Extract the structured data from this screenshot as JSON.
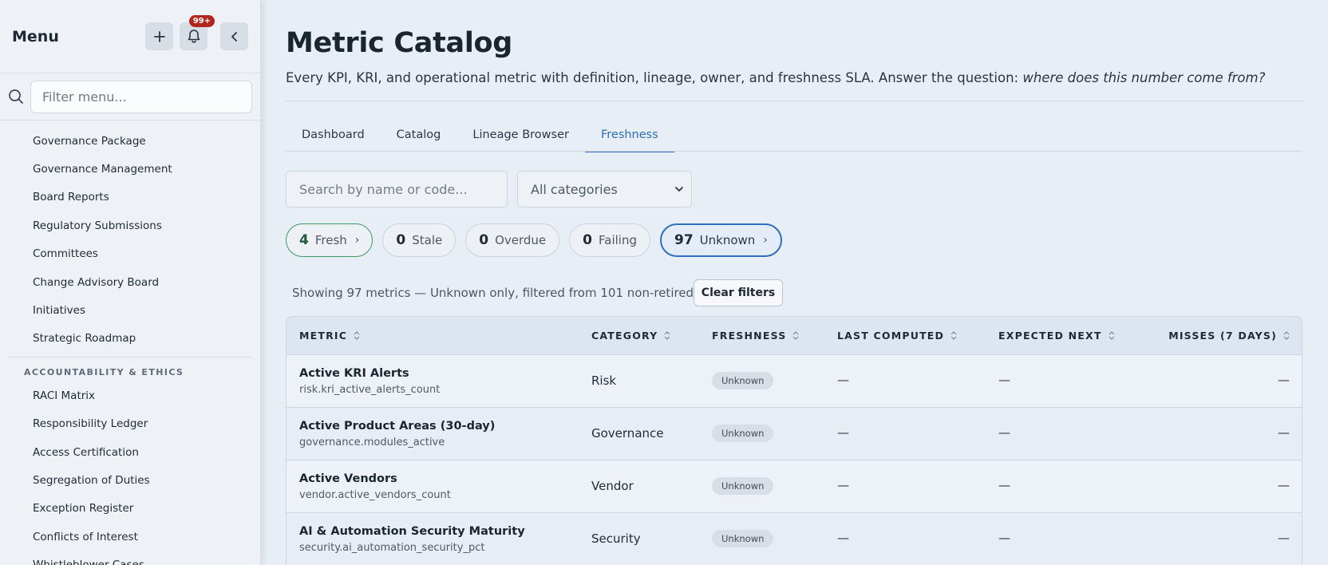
{
  "sidebar": {
    "title": "Menu",
    "notification_badge": "99+",
    "filter_placeholder": "Filter menu...",
    "items_top": [
      "Governance Package",
      "Governance Management",
      "Board Reports",
      "Regulatory Submissions",
      "Committees",
      "Change Advisory Board",
      "Initiatives",
      "Strategic Roadmap"
    ],
    "section_label": "ACCOUNTABILITY & ETHICS",
    "items_section": [
      "RACI Matrix",
      "Responsibility Ledger",
      "Access Certification",
      "Segregation of Duties",
      "Exception Register",
      "Conflicts of Interest",
      "Whistleblower Cases"
    ]
  },
  "page": {
    "title": "Metric Catalog",
    "subtitle_plain": "Every KPI, KRI, and operational metric with definition, lineage, owner, and freshness SLA. Answer the question:",
    "subtitle_emphasis": "where does this number come from?"
  },
  "tabs": [
    {
      "label": "Dashboard",
      "active": false
    },
    {
      "label": "Catalog",
      "active": false
    },
    {
      "label": "Lineage Browser",
      "active": false
    },
    {
      "label": "Freshness",
      "active": true
    }
  ],
  "filters": {
    "search_placeholder": "Search by name or code...",
    "category_selected": "All categories"
  },
  "status_pills": [
    {
      "count": "4",
      "label": "Fresh",
      "has_arrow": true
    },
    {
      "count": "0",
      "label": "Stale",
      "has_arrow": false
    },
    {
      "count": "0",
      "label": "Overdue",
      "has_arrow": false
    },
    {
      "count": "0",
      "label": "Failing",
      "has_arrow": false
    },
    {
      "count": "97",
      "label": "Unknown",
      "has_arrow": true
    }
  ],
  "summary": {
    "showing_text": "Showing 97 metrics — Unknown only, filtered from 101 non-retired metrics",
    "clear_label": "Clear filters"
  },
  "table": {
    "columns": [
      "METRIC",
      "CATEGORY",
      "FRESHNESS",
      "LAST COMPUTED",
      "EXPECTED NEXT",
      "MISSES (7 DAYS)"
    ],
    "rows": [
      {
        "name": "Active KRI Alerts",
        "code": "risk.kri_active_alerts_count",
        "category": "Risk",
        "freshness": "Unknown",
        "last": "—",
        "next": "—",
        "misses": "—"
      },
      {
        "name": "Active Product Areas (30-day)",
        "code": "governance.modules_active",
        "category": "Governance",
        "freshness": "Unknown",
        "last": "—",
        "next": "—",
        "misses": "—"
      },
      {
        "name": "Active Vendors",
        "code": "vendor.active_vendors_count",
        "category": "Vendor",
        "freshness": "Unknown",
        "last": "—",
        "next": "—",
        "misses": "—"
      },
      {
        "name": "AI & Automation Security Maturity",
        "code": "security.ai_automation_security_pct",
        "category": "Security",
        "freshness": "Unknown",
        "last": "—",
        "next": "—",
        "misses": "—"
      }
    ]
  }
}
